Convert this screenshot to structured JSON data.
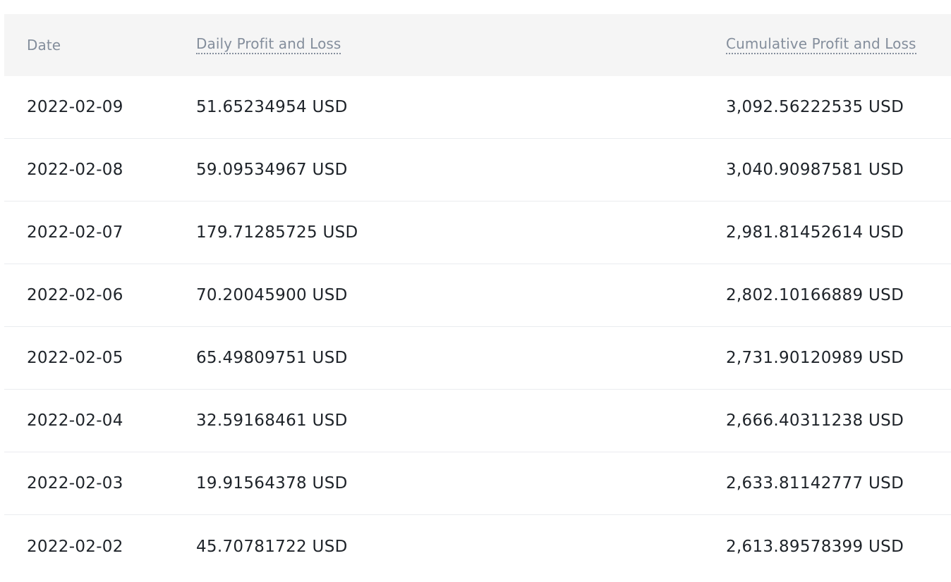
{
  "table": {
    "headers": {
      "date": "Date",
      "daily": "Daily Profit and Loss",
      "cumulative": "Cumulative Profit and Loss"
    },
    "rows": [
      {
        "date": "2022-02-09",
        "daily": "51.65234954 USD",
        "cumulative": "3,092.56222535 USD"
      },
      {
        "date": "2022-02-08",
        "daily": "59.09534967 USD",
        "cumulative": "3,040.90987581 USD"
      },
      {
        "date": "2022-02-07",
        "daily": "179.71285725 USD",
        "cumulative": "2,981.81452614 USD"
      },
      {
        "date": "2022-02-06",
        "daily": "70.20045900 USD",
        "cumulative": "2,802.10166889 USD"
      },
      {
        "date": "2022-02-05",
        "daily": "65.49809751 USD",
        "cumulative": "2,731.90120989 USD"
      },
      {
        "date": "2022-02-04",
        "daily": "32.59168461 USD",
        "cumulative": "2,666.40311238 USD"
      },
      {
        "date": "2022-02-03",
        "daily": "19.91564378 USD",
        "cumulative": "2,633.81142777 USD"
      },
      {
        "date": "2022-02-02",
        "daily": "45.70781722 USD",
        "cumulative": "2,613.89578399 USD"
      }
    ]
  }
}
